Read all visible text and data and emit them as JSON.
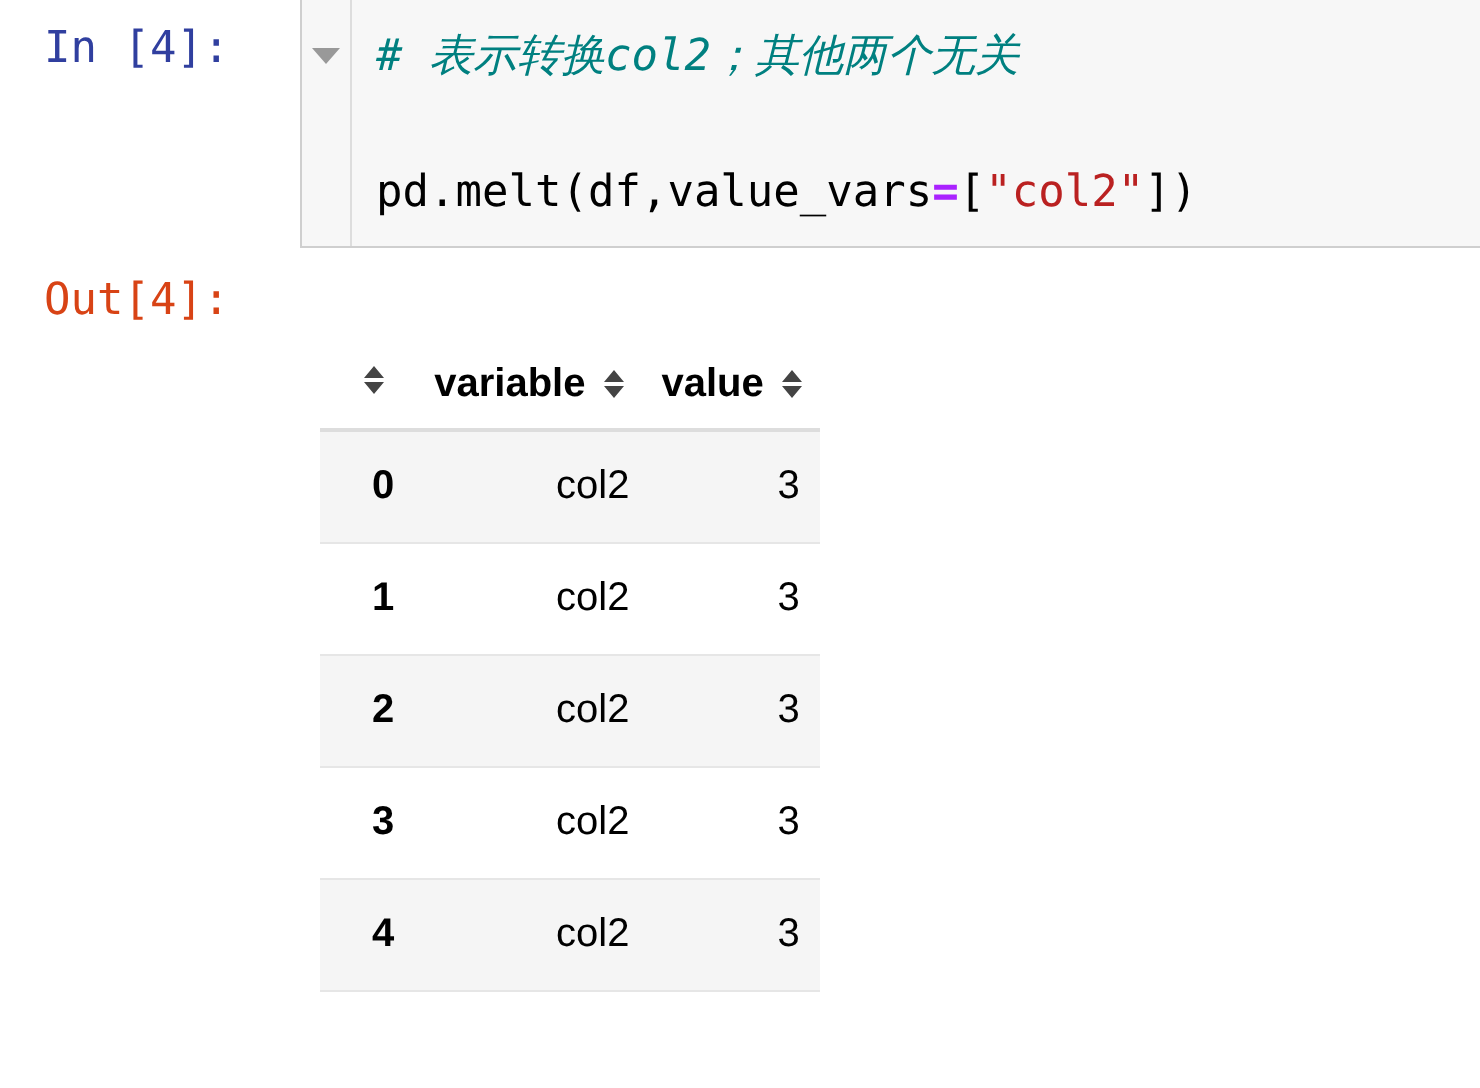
{
  "input_cell": {
    "prompt": "In [4]:",
    "code_lines": [
      [
        {
          "kind": "comment",
          "text": "# 表示转换col2；其他两个无关"
        }
      ],
      [
        {
          "kind": "plain",
          "text": "pd.melt(df,value_vars"
        },
        {
          "kind": "operator",
          "text": "="
        },
        {
          "kind": "plain",
          "text": "["
        },
        {
          "kind": "string",
          "text": "\"col2\""
        },
        {
          "kind": "plain",
          "text": "])"
        }
      ]
    ]
  },
  "output_cell": {
    "prompt": "Out[4]:",
    "table": {
      "columns": [
        {
          "label": "variable"
        },
        {
          "label": "value"
        }
      ],
      "rows": [
        {
          "index": "0",
          "cells": [
            "col2",
            "3"
          ]
        },
        {
          "index": "1",
          "cells": [
            "col2",
            "3"
          ]
        },
        {
          "index": "2",
          "cells": [
            "col2",
            "3"
          ]
        },
        {
          "index": "3",
          "cells": [
            "col2",
            "3"
          ]
        },
        {
          "index": "4",
          "cells": [
            "col2",
            "3"
          ]
        }
      ]
    }
  }
}
